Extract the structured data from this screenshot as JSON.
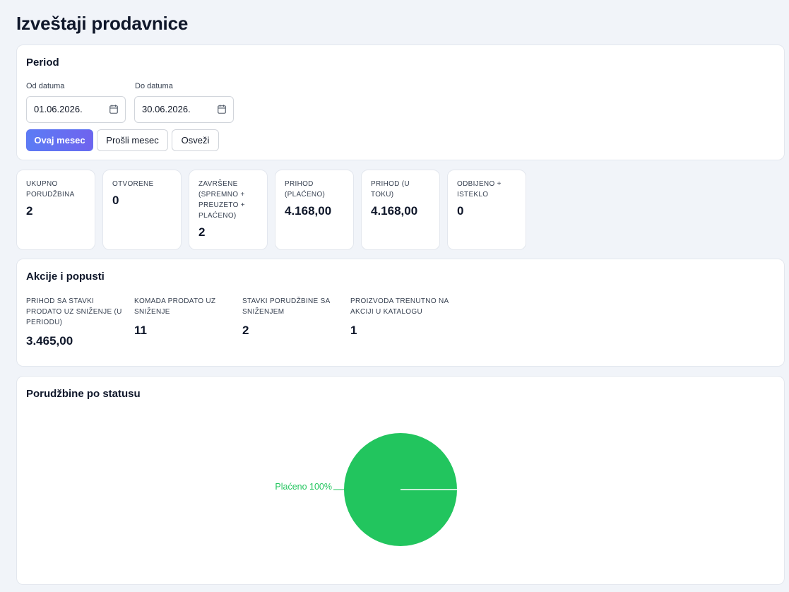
{
  "page": {
    "title": "Izveštaji prodavnice"
  },
  "period": {
    "title": "Period",
    "from_label": "Od datuma",
    "from_value": "01.06.2026.",
    "to_label": "Do datuma",
    "to_value": "30.06.2026.",
    "buttons": {
      "this_month": "Ovaj mesec",
      "last_month": "Prošli mesec",
      "refresh": "Osveži"
    }
  },
  "stats": [
    {
      "label": "UKUPNO PORUDŽBINA",
      "value": "2"
    },
    {
      "label": "OTVORENE",
      "value": "0"
    },
    {
      "label": "ZAVRŠENE (SPREMNO + PREUZETO + PLAĆENO)",
      "value": "2"
    },
    {
      "label": "PRIHOD (PLAĆENO)",
      "value": "4.168,00"
    },
    {
      "label": "PRIHOD (U TOKU)",
      "value": "4.168,00"
    },
    {
      "label": "ODBIJENO + ISTEKLO",
      "value": "0"
    }
  ],
  "promotions": {
    "title": "Akcije i popusti",
    "items": [
      {
        "label": "PRIHOD SA STAVKI PRODATO UZ SNIŽENJE (U PERIODU)",
        "value": "3.465,00"
      },
      {
        "label": "KOMADA PRODATO UZ SNIŽENJE",
        "value": "11"
      },
      {
        "label": "STAVKI PORUDŽBINE SA SNIŽENJEM",
        "value": "2"
      },
      {
        "label": "PROIZVODA TRENUTNO NA AKCIJI U KATALOGU",
        "value": "1"
      }
    ]
  },
  "orders_chart": {
    "title": "Porudžbine po statusu"
  },
  "chart_data": {
    "type": "pie",
    "title": "Porudžbine po statusu",
    "slices": [
      {
        "label": "Plaćeno",
        "value": 100,
        "display": "Plaćeno 100%",
        "color": "#22c55e"
      }
    ]
  },
  "colors": {
    "accent": "#5b7cf5",
    "success": "#22c55e",
    "background": "#f1f4f9"
  },
  "icons": {
    "date_picker": "calendar-icon"
  }
}
